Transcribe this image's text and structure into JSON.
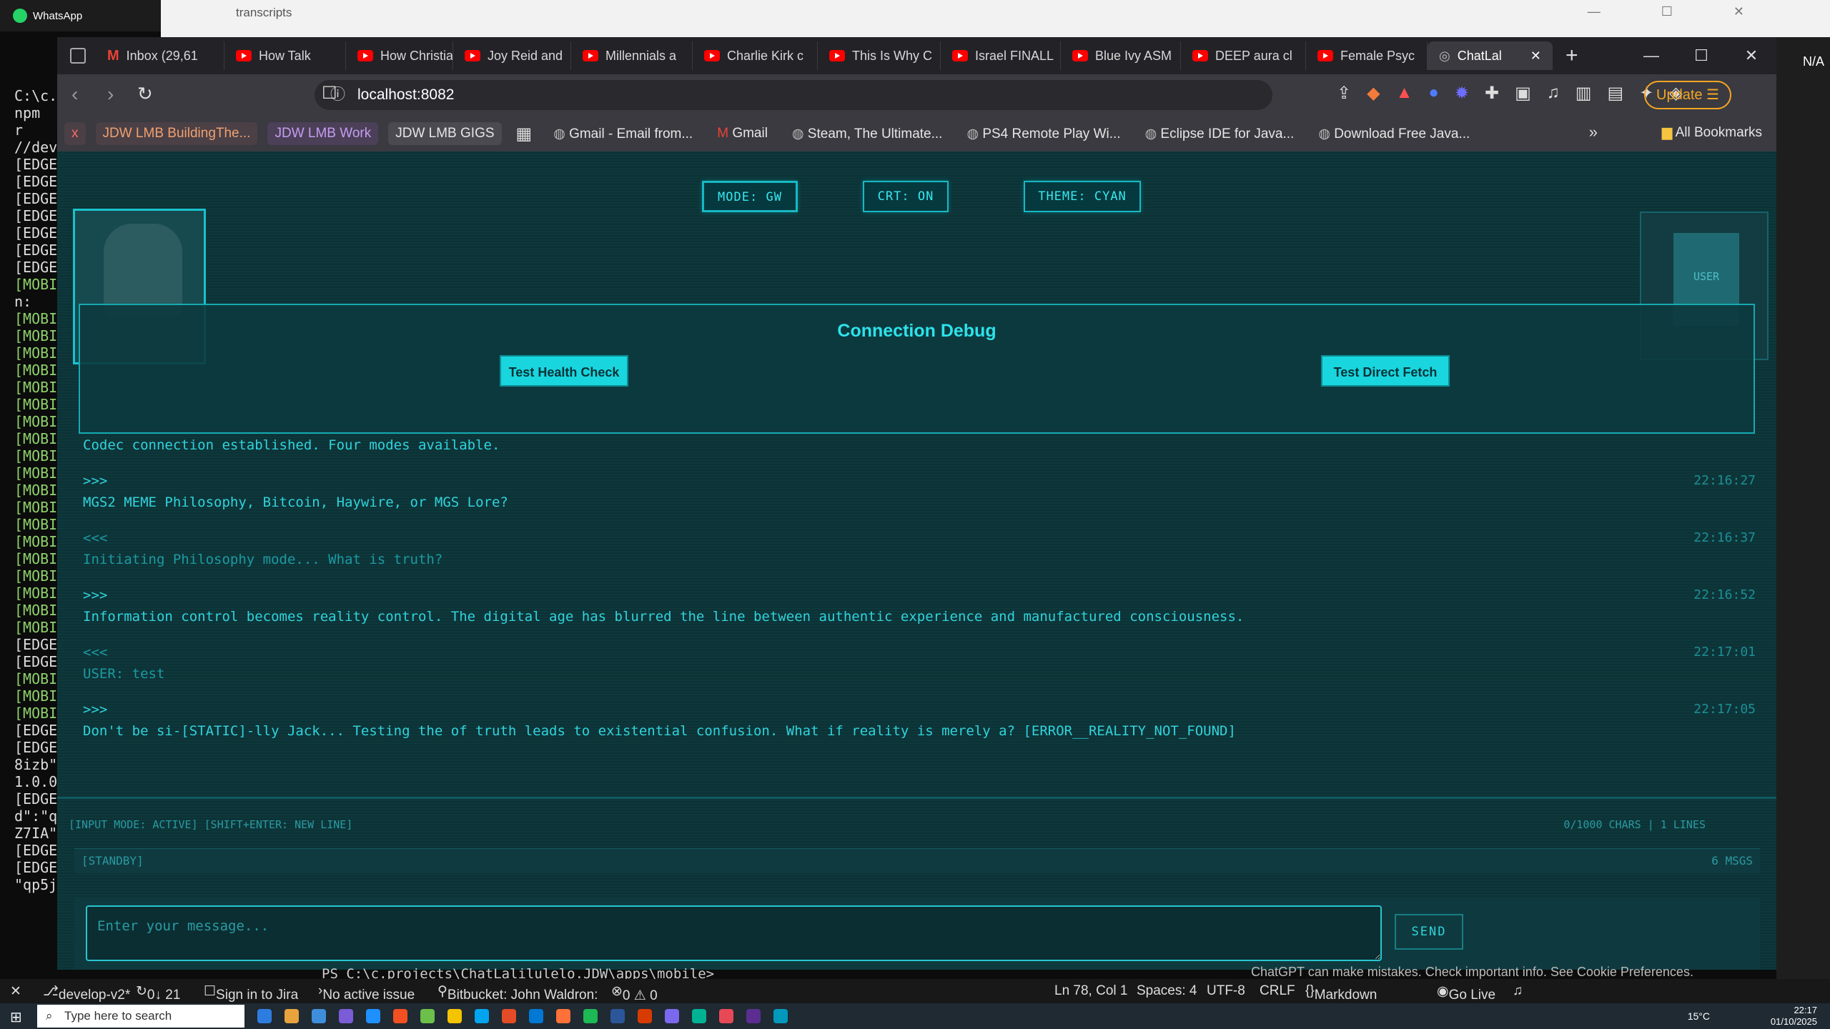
{
  "whatsapp": {
    "title": "WhatsApp"
  },
  "explorer": {
    "title": "transcripts",
    "controls": "— ☐ ✕"
  },
  "terminal_left": {
    "lines": [
      "C:\\c.p",
      "npm r",
      "//dev",
      "[EDGE",
      "[EDGE",
      "[EDGE",
      "[EDGE",
      "[EDGE",
      "[EDGE",
      "[EDGE",
      "[MOBI",
      "n:",
      "[MOBI",
      "[MOBI",
      "[MOBI",
      "[MOBI",
      "[MOBI",
      "[MOBI",
      "[MOBI",
      "[MOBI",
      "[MOBI",
      "[MOBI",
      "[MOBI",
      "[MOBI",
      "[MOBI",
      "[MOBI",
      "[MOBI",
      "[MOBI",
      "[MOBI",
      "[MOBI",
      "[MOBI",
      "[EDGE",
      "[EDGE",
      "[MOBI",
      "[MOBI",
      "[MOBI",
      "[EDGE",
      "[EDGE",
      "8izb\"",
      "1.0.0",
      "[EDGE",
      "d\":\"q",
      "Z7IA\"",
      "[EDGE",
      "[EDGE",
      "\"qp5j"
    ]
  },
  "right_strip": {
    "label": "N/A"
  },
  "browser": {
    "tabs": [
      {
        "label": "Inbox (29,61",
        "icon": "gmail-icon"
      },
      {
        "label": "How Talk",
        "icon": "youtube-icon"
      },
      {
        "label": "How Christia",
        "icon": "youtube-icon"
      },
      {
        "label": "Joy Reid and",
        "icon": "youtube-icon"
      },
      {
        "label": "Millennials a",
        "icon": "youtube-icon"
      },
      {
        "label": "Charlie Kirk c",
        "icon": "youtube-icon"
      },
      {
        "label": "This Is Why C",
        "icon": "youtube-icon"
      },
      {
        "label": "Israel FINALL",
        "icon": "youtube-icon"
      },
      {
        "label": "Blue Ivy ASM",
        "icon": "youtube-icon"
      },
      {
        "label": "DEEP aura cl",
        "icon": "youtube-icon"
      },
      {
        "label": "Female Psyc",
        "icon": "youtube-icon"
      },
      {
        "label": "ChatLal",
        "icon": "globe-icon"
      }
    ],
    "url": "localhost:8082",
    "update_label": "Update",
    "bookmarks": [
      {
        "label": "x",
        "style": "x"
      },
      {
        "label": "JDW LMB BuildingThe...",
        "style": "pill"
      },
      {
        "label": "JDW LMB Work",
        "style": "pill2"
      },
      {
        "label": "JDW LMB GIGS",
        "style": "pill3"
      },
      {
        "label": "Gmail - Email from...",
        "style": ""
      },
      {
        "label": "Gmail",
        "style": ""
      },
      {
        "label": "Steam, The Ultimate...",
        "style": ""
      },
      {
        "label": "PS4 Remote Play Wi...",
        "style": ""
      },
      {
        "label": "Eclipse IDE for Java...",
        "style": ""
      },
      {
        "label": "Download Free Java...",
        "style": ""
      }
    ],
    "all_bookmarks": "All Bookmarks"
  },
  "app": {
    "mode_label": "MODE: GW",
    "crt_label": "CRT: ON",
    "theme_label": "THEME: CYAN",
    "user_label": "USER",
    "debug_title": "Connection Debug",
    "health_btn": "Test Health Check",
    "fetch_btn": "Test Direct Fetch",
    "messages": [
      {
        "text": "Codec connection established. Four modes available.",
        "time": "",
        "dim": false
      },
      {
        "text": ">>>",
        "time": "22:16:27",
        "dim": false
      },
      {
        "text": "MGS2 MEME Philosophy, Bitcoin, Haywire, or MGS Lore?",
        "time": "",
        "dim": false
      },
      {
        "text": "<<<",
        "time": "22:16:37",
        "dim": true
      },
      {
        "text": "Initiating Philosophy mode... What is truth?",
        "time": "",
        "dim": true
      },
      {
        "text": ">>>",
        "time": "22:16:52",
        "dim": false
      },
      {
        "text": "Information control becomes reality control. The digital age has blurred the line between authentic experience and manufactured consciousness.",
        "time": "",
        "dim": false
      },
      {
        "text": "<<<",
        "time": "22:17:01",
        "dim": true
      },
      {
        "text": "USER: test",
        "time": "",
        "dim": true
      },
      {
        "text": ">>>",
        "time": "22:17:05",
        "dim": false
      },
      {
        "text": "Don't be si-[STATIC]-lly Jack... Testing the of truth leads to existential confusion. What if reality is merely a? [ERROR__REALITY_NOT_FOUND]",
        "time": "",
        "dim": false
      }
    ],
    "status_left": "[STANDBY]",
    "status_right": "6 MSGS",
    "input_placeholder": "Enter your message...",
    "send_label": "SEND",
    "footer_left": "[INPUT MODE: ACTIVE] [SHIFT+ENTER: NEW LINE]",
    "footer_right": "0/1000 CHARS | 1 LINES"
  },
  "vscode": {
    "branch": "develop-v2*",
    "sync": "0↓ 21",
    "jira": "Sign in to Jira",
    "issue": "No active issue",
    "bitbucket": "Bitbucket: John Waldron:",
    "problems": "0 ⚠ 0",
    "position": "Ln 78, Col 1",
    "spaces": "Spaces: 4",
    "encoding": "UTF-8",
    "eol": "CRLF",
    "language": "Markdown",
    "golive": "Go Live",
    "term_line": "PS C:\\c.projects\\ChatLalilulelo.JDW\\apps\\mobile>",
    "chatgpt_note": "ChatGPT can make mistakes. Check important info. See Cookie Preferences."
  },
  "taskbar": {
    "search": "Type here to search",
    "weather": "15°C",
    "time": "22:17",
    "date": "01/10/2025",
    "icon_colors": [
      "#2d7de0",
      "#e8a33d",
      "#3f8edc",
      "#7a5cd6",
      "#1e90ff",
      "#f25022",
      "#6cc04a",
      "#f5c400",
      "#00a4ef",
      "#e34c26",
      "#0078d4",
      "#ff7139",
      "#1db954",
      "#2b579a",
      "#d83b01",
      "#7b68ee",
      "#00b294",
      "#e74856",
      "#5c2d91",
      "#0099bc"
    ]
  }
}
